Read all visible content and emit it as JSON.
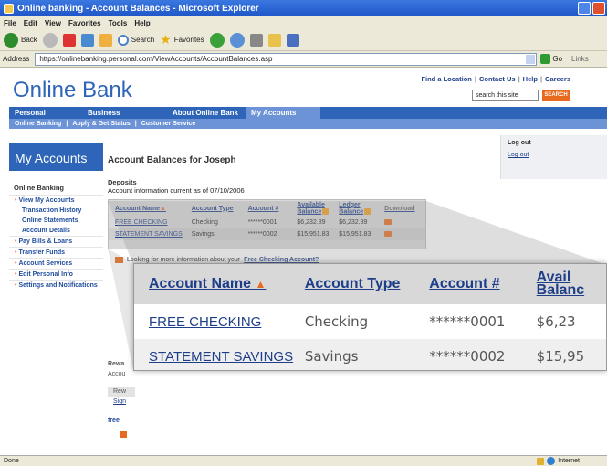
{
  "browser": {
    "title": "Online banking - Account Balances - Microsoft Explorer",
    "menu": [
      "File",
      "Edit",
      "View",
      "Favorites",
      "Tools",
      "Help"
    ],
    "toolbar": {
      "back": "Back",
      "search": "Search",
      "favorites": "Favorites"
    },
    "address_label": "Address",
    "address_url": "https://onlinebanking.personal.com/ViewAccounts/AccountBalances.asp",
    "go": "Go",
    "links": "Links",
    "status_text": "Done",
    "zone_text": "Internet"
  },
  "site": {
    "brand": "Online Bank",
    "top_links": [
      "Find a Location",
      "Contact Us",
      "Help",
      "Careers"
    ],
    "search_placeholder": "search this site",
    "search_button": "SEARCH",
    "nav": [
      "Personal",
      "Business",
      "About Online Bank",
      "My Accounts"
    ],
    "subnav": [
      "Online Banking",
      "Apply & Get Status",
      "Customer Service"
    ]
  },
  "sidebar": {
    "title": "My Accounts",
    "heading": "Online Banking",
    "items": [
      {
        "label": "View My Accounts",
        "type": "top"
      },
      {
        "label": "Transaction History",
        "type": "sub"
      },
      {
        "label": "Online Statements",
        "type": "sub"
      },
      {
        "label": "Account Details",
        "type": "sub"
      },
      {
        "label": "Pay Bills & Loans",
        "type": "top"
      },
      {
        "label": "Transfer Funds",
        "type": "top"
      },
      {
        "label": "Account Services",
        "type": "top"
      },
      {
        "label": "Edit Personal Info",
        "type": "top"
      },
      {
        "label": "Settings and Notifications",
        "type": "top"
      }
    ]
  },
  "main": {
    "heading": "Account Balances for Joseph",
    "logout_heading": "Log out",
    "logout_link": "Log out",
    "deposits_heading": "Deposits",
    "deposits_sub": "Account information current as of 07/10/2006",
    "columns": [
      "Account Name",
      "Account Type",
      "Account #",
      "Available Balance",
      "Ledger Balance",
      "Download"
    ],
    "rows": [
      {
        "name": "FREE CHECKING",
        "type": "Checking",
        "number": "******0001",
        "available": "$6,232.89",
        "ledger": "$6,232.89"
      },
      {
        "name": "STATEMENT SAVINGS",
        "type": "Savings",
        "number": "******0002",
        "available": "$15,951.83",
        "ledger": "$15,951.83"
      }
    ],
    "more_info_text": "Looking for more information about your",
    "more_info_link": "Free Checking Account?",
    "rewards_label": "Rewa",
    "rewards_sub": "Accou",
    "tiny_tab": "Rew",
    "tiny_link": "Sign",
    "free_label": "free"
  },
  "zoom": {
    "columns": [
      "Account Name",
      "Account Type",
      "Account #",
      "Avail",
      "Balanc"
    ],
    "rows": [
      {
        "name": "FREE CHECKING",
        "type": "Checking",
        "number": "******0001",
        "available": "$6,23"
      },
      {
        "name": "STATEMENT SAVINGS",
        "type": "Savings",
        "number": "******0002",
        "available": "$15,95"
      }
    ]
  },
  "colors": {
    "brand_blue": "#2f65b8",
    "accent_orange": "#e86a1e",
    "link_navy": "#1e3e8a"
  }
}
